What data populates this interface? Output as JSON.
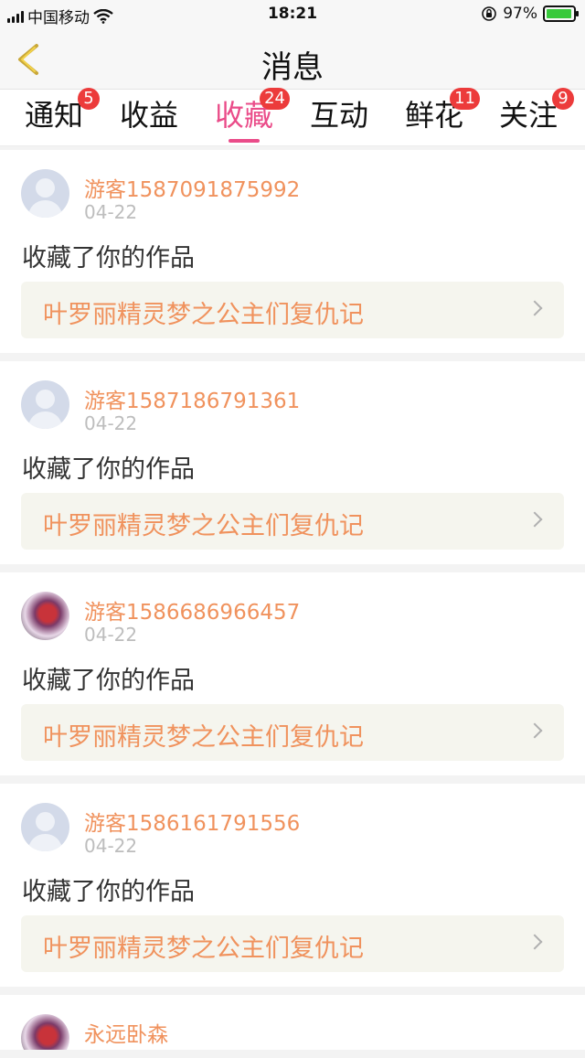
{
  "status_bar": {
    "carrier": "中国移动",
    "time": "18:21",
    "battery_percent": "97%",
    "battery_level": 0.97,
    "battery_color": "#38c93c"
  },
  "nav": {
    "back_icon": "chevron-left-icon",
    "title": "消息"
  },
  "tabs": [
    {
      "label": "通知",
      "badge": "5",
      "active": false
    },
    {
      "label": "收益",
      "badge": "",
      "active": false
    },
    {
      "label": "收藏",
      "badge": "24",
      "active": true
    },
    {
      "label": "互动",
      "badge": "",
      "active": false
    },
    {
      "label": "鲜花",
      "badge": "11",
      "active": false
    },
    {
      "label": "关注",
      "badge": "9",
      "active": false
    }
  ],
  "colors": {
    "accent": "#ea4c89",
    "username": "#f0925d",
    "badge": "#ec3b3b"
  },
  "messages": [
    {
      "user": "游客1587091875992",
      "date": "04-22",
      "action": "收藏了你的作品",
      "work_title": "叶罗丽精灵梦之公主们复仇记",
      "avatar": "default-avatar-icon"
    },
    {
      "user": "游客1587186791361",
      "date": "04-22",
      "action": "收藏了你的作品",
      "work_title": "叶罗丽精灵梦之公主们复仇记",
      "avatar": "default-avatar-icon"
    },
    {
      "user": "游客1586686966457",
      "date": "04-22",
      "action": "收藏了你的作品",
      "work_title": "叶罗丽精灵梦之公主们复仇记",
      "avatar": "photo-avatar"
    },
    {
      "user": "游客1586161791556",
      "date": "04-22",
      "action": "收藏了你的作品",
      "work_title": "叶罗丽精灵梦之公主们复仇记",
      "avatar": "default-avatar-icon"
    },
    {
      "user": "永远卧森",
      "date": "",
      "action": "",
      "work_title": "",
      "avatar": "photo-avatar"
    }
  ]
}
